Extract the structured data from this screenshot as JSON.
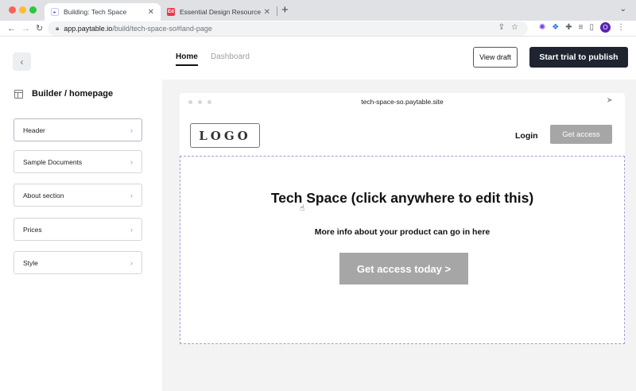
{
  "browser": {
    "tabs": [
      {
        "title": "Building: Tech Space",
        "favicon": "paytable-favicon",
        "active": true
      },
      {
        "title": "Essential Design Resources - S",
        "favicon": "ed-favicon",
        "active": false
      }
    ],
    "url_host": "app.paytable.io",
    "url_path": "/build/tech-space-so#land-page",
    "avatar_letter": "O",
    "extension_badge": "2"
  },
  "header": {
    "tabs": [
      {
        "label": "Home",
        "active": true
      },
      {
        "label": "Dashboard",
        "active": false
      }
    ],
    "view_draft_label": "View draft",
    "start_trial_label": "Start trial to publish"
  },
  "sidebar": {
    "title": "Builder / homepage",
    "items": [
      {
        "label": "Header"
      },
      {
        "label": "Sample Documents"
      },
      {
        "label": "About section"
      },
      {
        "label": "Prices"
      },
      {
        "label": "Style"
      }
    ]
  },
  "preview": {
    "frame_url": "tech-space-so.paytable.site",
    "logo_text": "LOGO",
    "login_label": "Login",
    "get_access_label": "Get access",
    "hero_title": "Tech Space (click anywhere to edit this)",
    "hero_subtitle": "More info about your product can go in here",
    "cta_label": "Get access today >"
  },
  "colors": {
    "primary_dark": "#1f2430",
    "placeholder_gray": "#a6a6a6",
    "edit_outline": "#9f9fd6"
  }
}
